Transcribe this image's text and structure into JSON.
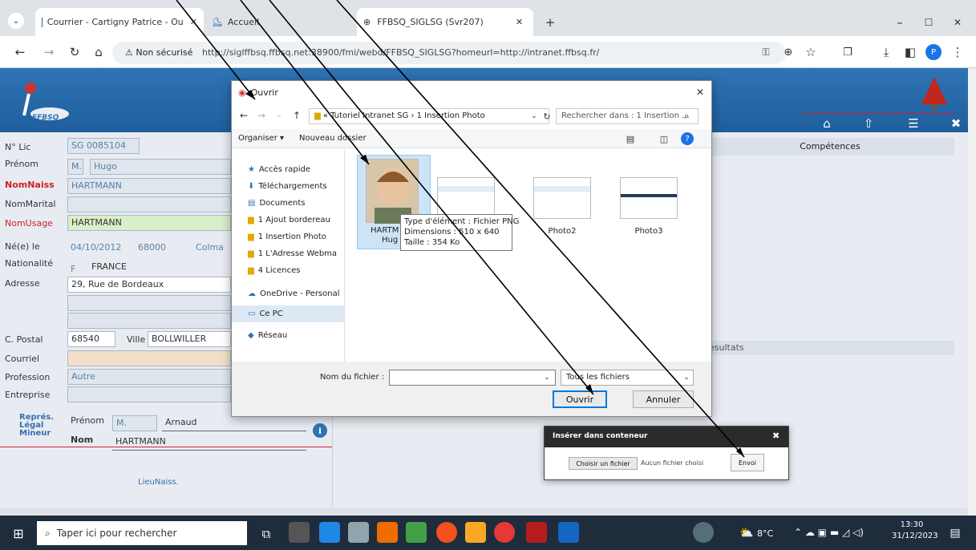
{
  "tabs": [
    {
      "label": "Courrier - Cartigny Patrice - Ou"
    },
    {
      "label": "Accueil"
    },
    {
      "label": "FFBSQ_SIGLSG (Svr207)"
    }
  ],
  "url": {
    "security": "Non sécurisé",
    "text": "http://siglffbsq.ffbsq.net:38900/fmi/webd/FFBSQ_SIGLSG?homeurl=http://intranet.ffbsq.fr/"
  },
  "header": {
    "logo": "FFBSQ"
  },
  "form": {
    "lic_label": "N° Lic",
    "lic_value": "SG 0085104",
    "prenom_label": "Prénom",
    "prenom_init": "M.",
    "prenom_value": "Hugo",
    "nomnaiss_label": "NomNaiss",
    "nomnaiss_value": "HARTMANN",
    "nommarital_label": "NomMarital",
    "nomusage_label": "NomUsage",
    "nomusage_value": "HARTMANN",
    "ne_label": "Né(e) le",
    "ne_date": "04/10/2012",
    "ne_cp": "68000",
    "ne_ville": "Colma",
    "nat_label": "Nationalité",
    "nat_code": "F",
    "nat_value": "FRANCE",
    "adresse_label": "Adresse",
    "adresse_value": "29, Rue de Bordeaux",
    "cp_label": "C. Postal",
    "cp_value": "68540",
    "ville_label": "Ville",
    "ville_value": "BOLLWILLER",
    "courriel_label": "Courriel",
    "profession_label": "Profession",
    "profession_value": "Autre",
    "entreprise_label": "Entreprise",
    "repres_label": "Représ. Légal Mineur",
    "rep_prenom_label": "Prénom",
    "rep_prenom_init": "M.",
    "rep_prenom_value": "Arnaud",
    "rep_nom_label": "Nom",
    "rep_nom_value": "HARTMANN",
    "lieunaiss": "LieuNaiss.",
    "competences": "Compétences",
    "resultats": "esultats"
  },
  "dialog": {
    "title": "Ouvrir",
    "crumbs": "« Tutoriel Intranet SG › 1 Insertion Photo",
    "search_placeholder": "Rechercher dans : 1 Insertion ...",
    "organiser": "Organiser ▾",
    "new_folder": "Nouveau dossier",
    "nav": [
      {
        "label": "Accès rapide"
      },
      {
        "label": "Téléchargements"
      },
      {
        "label": "Documents"
      },
      {
        "label": "1 Ajout bordereau"
      },
      {
        "label": "1 Insertion Photo"
      },
      {
        "label": "1 L'Adresse Webma"
      },
      {
        "label": "4 Licences"
      },
      {
        "label": "OneDrive - Personal"
      },
      {
        "label": "Ce PC"
      },
      {
        "label": "Réseau"
      }
    ],
    "files": [
      {
        "name1": "HARTM",
        "name2": "Hug"
      },
      {
        "name": "Photo2"
      },
      {
        "name": "Photo3"
      }
    ],
    "tooltip": {
      "l1": "Type d'élément : Fichier PNG",
      "l2": "Dimensions : 510 x 640",
      "l3": "Taille : 354 Ko"
    },
    "filename_label": "Nom du fichier :",
    "filter": "Tous les fichiers",
    "open": "Ouvrir",
    "cancel": "Annuler"
  },
  "insert": {
    "title": "Insérer dans conteneur",
    "choose": "Choisir un fichier",
    "nofile": "Aucun fichier choisi",
    "send": "Envoi"
  },
  "taskbar": {
    "search": "Taper ici pour rechercher",
    "temp": "8°C",
    "time": "13:30",
    "date": "31/12/2023"
  }
}
